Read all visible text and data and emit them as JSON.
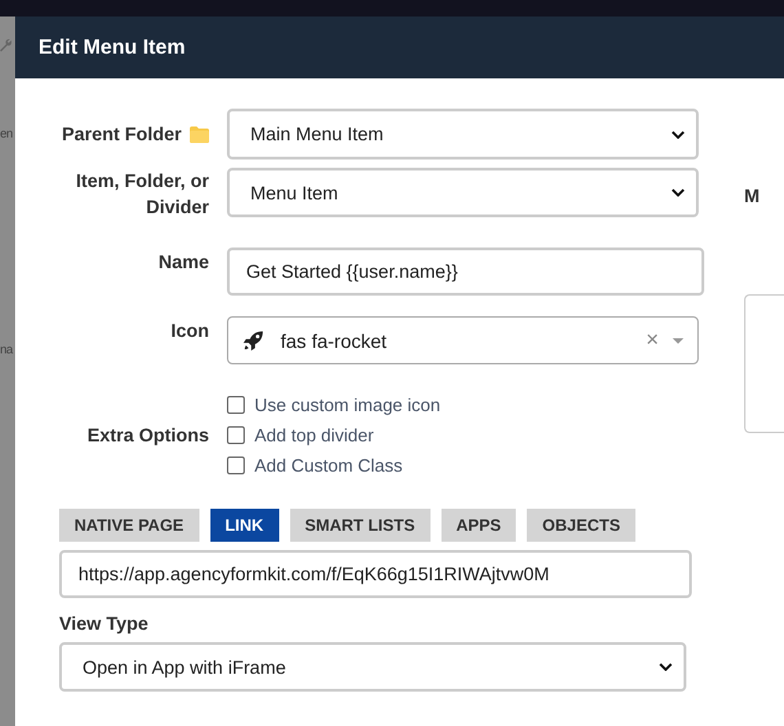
{
  "background": {
    "fragments": [
      "en",
      "na"
    ]
  },
  "modal": {
    "title": "Edit Menu Item"
  },
  "form": {
    "parent_folder": {
      "label": "Parent Folder",
      "value": "Main Menu Item"
    },
    "item_type": {
      "label": "Item, Folder, or Divider",
      "value": "Menu Item"
    },
    "name": {
      "label": "Name",
      "value": "Get Started {{user.name}}"
    },
    "icon": {
      "label": "Icon",
      "value": "fas fa-rocket",
      "clear": "×"
    },
    "extra_options": {
      "label": "Extra Options",
      "options": [
        {
          "label": "Use custom image icon",
          "checked": false
        },
        {
          "label": "Add top divider",
          "checked": false
        },
        {
          "label": "Add Custom Class",
          "checked": false
        }
      ]
    }
  },
  "right_panel": {
    "label": "M"
  },
  "link_tabs": [
    {
      "label": "NATIVE PAGE",
      "selected": false
    },
    {
      "label": "LINK",
      "selected": true
    },
    {
      "label": "SMART LISTS",
      "selected": false
    },
    {
      "label": "APPS",
      "selected": false
    },
    {
      "label": "OBJECTS",
      "selected": false
    }
  ],
  "url": {
    "value": "https://app.agencyformkit.com/f/EqK66g15I1RIWAjtvw0M"
  },
  "view_type": {
    "label": "View Type",
    "value": "Open in App with iFrame"
  }
}
